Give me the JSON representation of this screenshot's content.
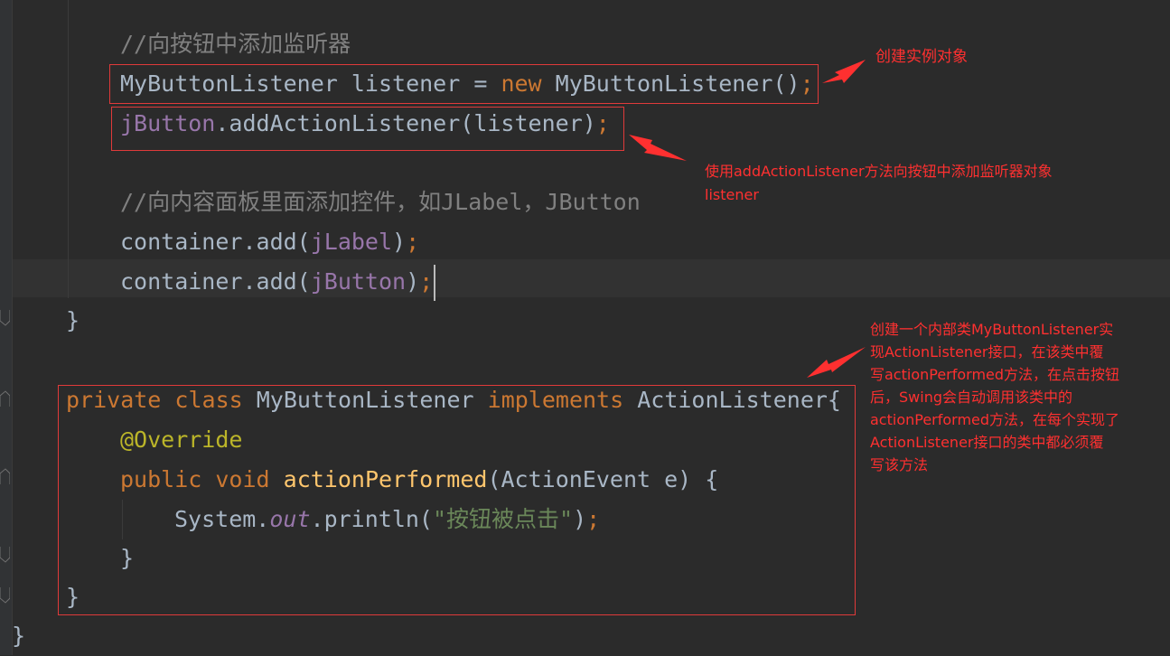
{
  "code": {
    "comment_listener": "//向按钮中添加监听器",
    "line_listener_type": "MyButtonListener listener = ",
    "kw_new": "new",
    "line_listener_ctor": " MyButtonListener()",
    "semicolon": ";",
    "jbutton_field": "jButton",
    "add_listener_call": ".addActionListener(listener)",
    "comment_container": "//向内容面板里面添加控件，如JLabel，JButton",
    "container_add_prefix": "container.add(",
    "jlabel_field": "jLabel",
    "close_paren": ")",
    "method_close_brace": "}",
    "kw_private": "private",
    "kw_class": "class",
    "class_name": "MyButtonListener",
    "kw_implements": "implements",
    "interface_with_brace": "ActionListener{",
    "annotation": "@Override",
    "kw_public": "public",
    "kw_void": "void",
    "method_name": "actionPerformed",
    "method_params": "(ActionEvent e) {",
    "system_prefix": "System.",
    "out_field": "out",
    "println_open": ".println(",
    "string_literal": "\"按钮被点击\"",
    "inner_close_brace": "}",
    "class_close_brace": "}",
    "outer_close_brace": "}"
  },
  "annotations": {
    "create_instance": "创建实例对象",
    "add_listener_line1": "使用addActionListener方法向按钮中添加监听器对象",
    "add_listener_line2": "listener",
    "inner_class_lines": [
      "创建一个内部类MyButtonListener实",
      "现ActionListener接口，在该类中覆",
      "写actionPerformed方法，在点击按钮",
      "后，Swing会自动调用该类中的",
      "actionPerformed方法，在每个实现了",
      "ActionListener接口的类中都必须覆",
      "写该方法"
    ]
  },
  "colors": {
    "background": "#2b2b2b",
    "annotation_red": "#ff3030",
    "keyword": "#cc7832",
    "comment": "#808080",
    "field": "#9876aa",
    "method": "#ffc66d",
    "string": "#6a8759"
  }
}
